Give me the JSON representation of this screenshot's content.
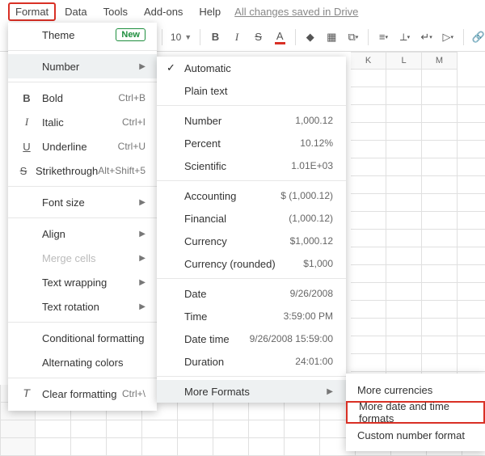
{
  "menubar": {
    "format": "Format",
    "data": "Data",
    "tools": "Tools",
    "addons": "Add-ons",
    "help": "Help",
    "saved": "All changes saved in Drive"
  },
  "toolbar": {
    "font_size": "10"
  },
  "format_menu": {
    "theme": "Theme",
    "new_badge": "New",
    "number": "Number",
    "bold": "Bold",
    "bold_sc": "Ctrl+B",
    "italic": "Italic",
    "italic_sc": "Ctrl+I",
    "underline": "Underline",
    "underline_sc": "Ctrl+U",
    "strike": "Strikethrough",
    "strike_sc": "Alt+Shift+5",
    "font_size": "Font size",
    "align": "Align",
    "merge": "Merge cells",
    "wrap": "Text wrapping",
    "rotation": "Text rotation",
    "cond": "Conditional formatting",
    "alt": "Alternating colors",
    "clear": "Clear formatting",
    "clear_sc": "Ctrl+\\"
  },
  "number_menu": {
    "automatic": "Automatic",
    "plain": "Plain text",
    "number": "Number",
    "number_v": "1,000.12",
    "percent": "Percent",
    "percent_v": "10.12%",
    "scientific": "Scientific",
    "scientific_v": "1.01E+03",
    "accounting": "Accounting",
    "accounting_v": "$ (1,000.12)",
    "financial": "Financial",
    "financial_v": "(1,000.12)",
    "currency": "Currency",
    "currency_v": "$1,000.12",
    "currency_r": "Currency (rounded)",
    "currency_r_v": "$1,000",
    "date": "Date",
    "date_v": "9/26/2008",
    "time": "Time",
    "time_v": "3:59:00 PM",
    "datetime": "Date time",
    "datetime_v": "9/26/2008 15:59:00",
    "duration": "Duration",
    "duration_v": "24:01:00",
    "more": "More Formats"
  },
  "more_menu": {
    "currencies": "More currencies",
    "datetime": "More date and time formats",
    "custom": "Custom number format"
  },
  "cols": {
    "k": "K",
    "l": "L",
    "m": "M"
  }
}
